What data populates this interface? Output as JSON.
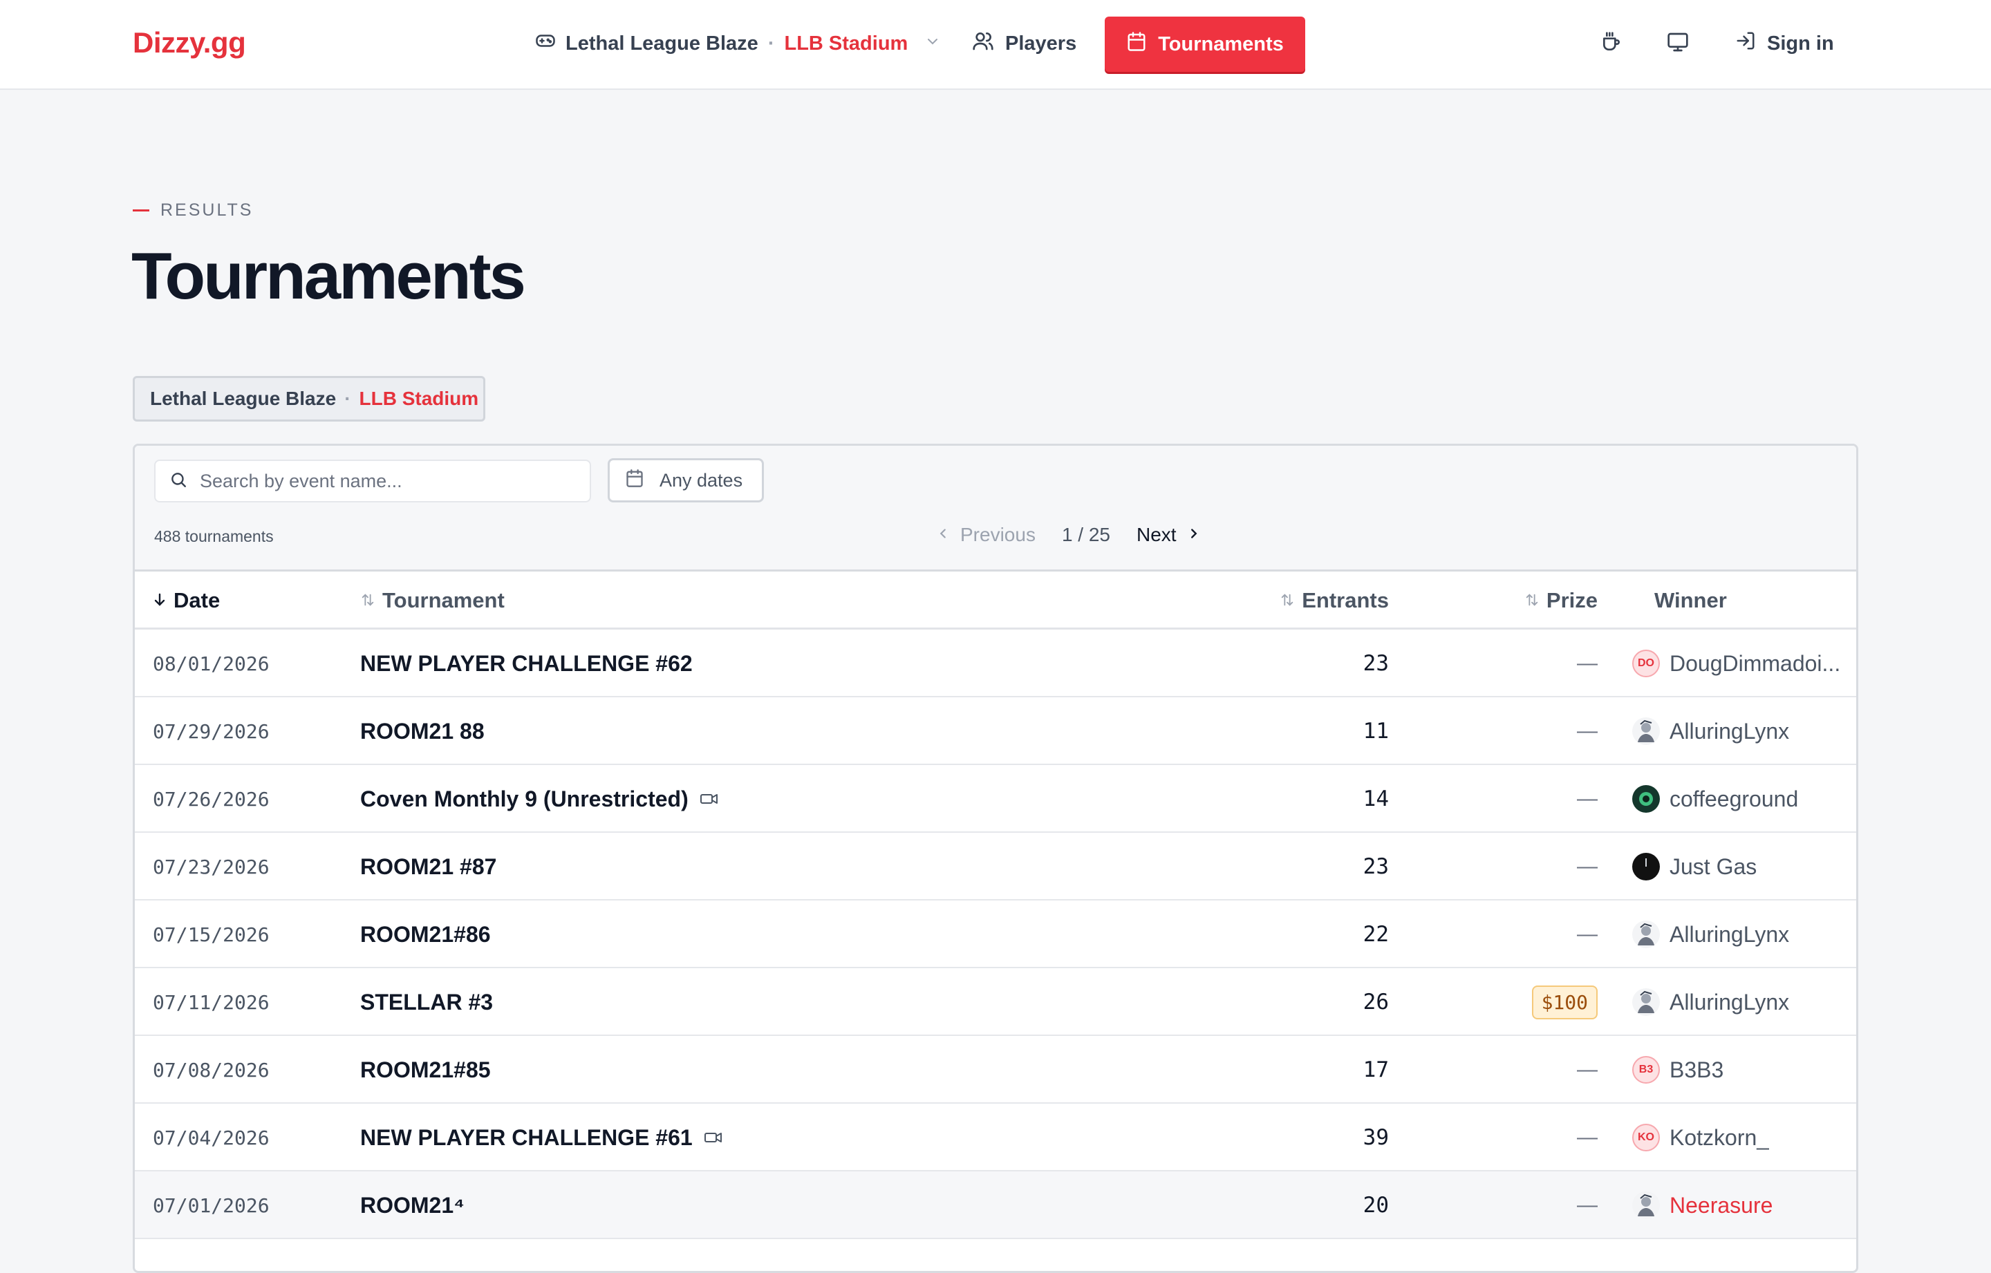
{
  "nav": {
    "logo": "Dizzy.gg",
    "game": "Lethal League Blaze",
    "separator": "·",
    "region": "LLB Stadium",
    "players": "Players",
    "tournaments": "Tournaments",
    "sign_in": "Sign in"
  },
  "header": {
    "eyebrow": "RESULTS",
    "title": "Tournaments"
  },
  "filter_chip": {
    "game": "Lethal League Blaze",
    "separator": "·",
    "region": "LLB Stadium"
  },
  "toolbar": {
    "search_placeholder": "Search by event name...",
    "dates_label": "Any dates",
    "count": "488 tournaments",
    "prev": "Previous",
    "page": "1 / 25",
    "next": "Next"
  },
  "table": {
    "columns": {
      "date": "Date",
      "tournament": "Tournament",
      "entrants": "Entrants",
      "prize": "Prize",
      "winner": "Winner"
    },
    "rows": [
      {
        "date": "08/01/2026",
        "name": "NEW PLAYER CHALLENGE #62",
        "entrants": "23",
        "prize": "—",
        "winner": "DougDimmadoi...",
        "avatar": "DO",
        "avatar_type": "initials",
        "vod": false
      },
      {
        "date": "07/29/2026",
        "name": "ROOM21 88",
        "entrants": "11",
        "prize": "—",
        "winner": "AlluringLynx",
        "avatar": "",
        "avatar_type": "pic-light",
        "vod": false
      },
      {
        "date": "07/26/2026",
        "name": "Coven Monthly 9 (Unrestricted)",
        "entrants": "14",
        "prize": "—",
        "winner": "coffeeground",
        "avatar": "",
        "avatar_type": "pic-green",
        "vod": true
      },
      {
        "date": "07/23/2026",
        "name": "ROOM21 #87",
        "entrants": "23",
        "prize": "—",
        "winner": "Just Gas",
        "avatar": "",
        "avatar_type": "pic-dark",
        "vod": false
      },
      {
        "date": "07/15/2026",
        "name": "ROOM21#86",
        "entrants": "22",
        "prize": "—",
        "winner": "AlluringLynx",
        "avatar": "",
        "avatar_type": "pic-light",
        "vod": false
      },
      {
        "date": "07/11/2026",
        "name": "STELLAR #3",
        "entrants": "26",
        "prize": "$100",
        "winner": "AlluringLynx",
        "avatar": "",
        "avatar_type": "pic-light",
        "vod": false
      },
      {
        "date": "07/08/2026",
        "name": "ROOM21#85",
        "entrants": "17",
        "prize": "—",
        "winner": "B3B3",
        "avatar": "B3",
        "avatar_type": "initials",
        "vod": false
      },
      {
        "date": "07/04/2026",
        "name": "NEW PLAYER CHALLENGE #61",
        "entrants": "39",
        "prize": "—",
        "winner": "Kotzkorn_",
        "avatar": "KO",
        "avatar_type": "initials",
        "vod": true
      },
      {
        "date": "07/01/2026",
        "name": "ROOM21⁴",
        "entrants": "20",
        "prize": "—",
        "winner": "Neerasure",
        "avatar": "",
        "avatar_type": "pic-light",
        "vod": false,
        "hover": true
      }
    ]
  },
  "colors": {
    "accent": "#ef3340",
    "background": "#f5f6f8"
  },
  "icons": {
    "game": "gamepad-icon",
    "players": "users-icon",
    "tournaments": "calendar-icon",
    "support": "coffee-icon",
    "display": "monitor-icon",
    "sign_in": "login-icon"
  }
}
